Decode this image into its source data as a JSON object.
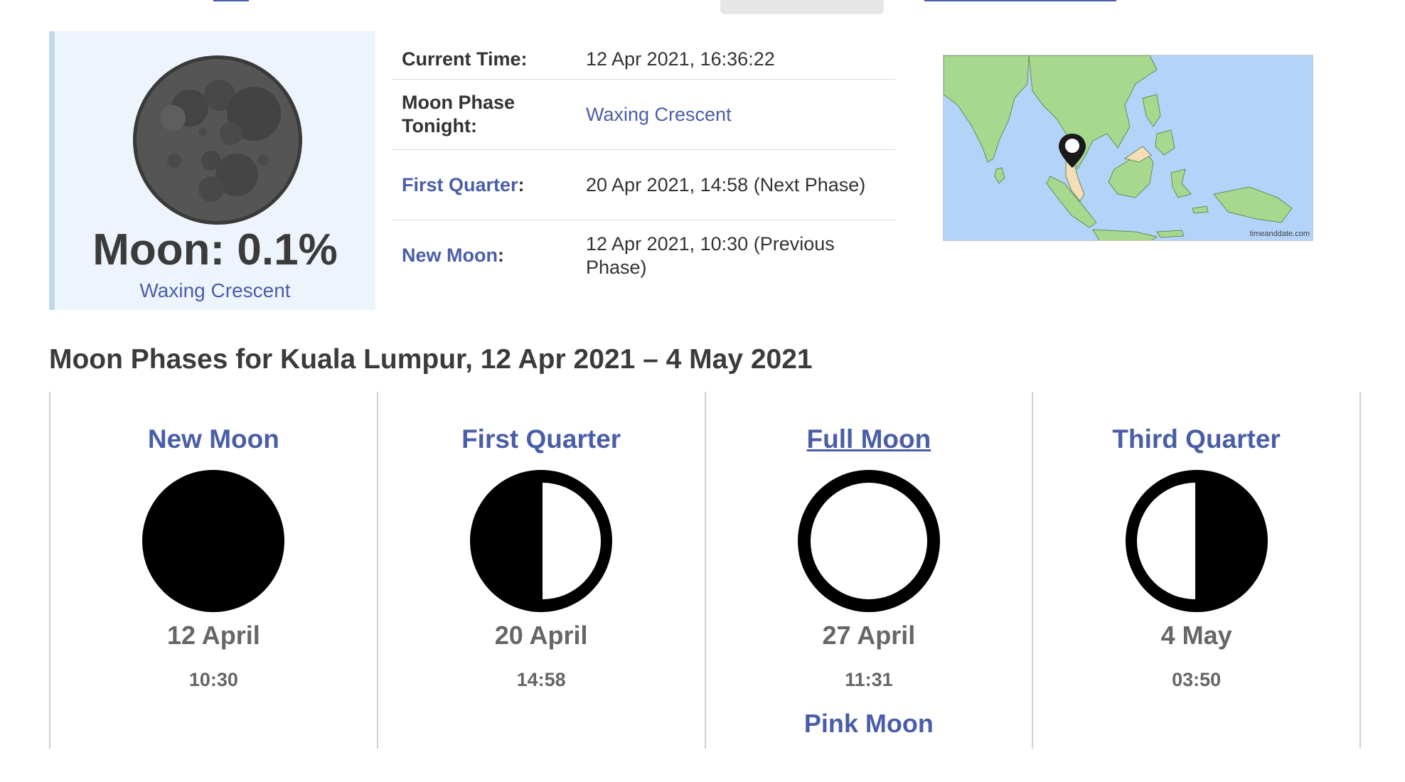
{
  "summary": {
    "percent_label": "Moon: 0.1%",
    "phase_label": "Waxing Crescent",
    "illumination_percent": 0.1
  },
  "info": {
    "current_time_label": "Current Time:",
    "current_time_value": "12 Apr 2021, 16:36:22",
    "tonight_label": "Moon Phase Tonight:",
    "tonight_value": "Waxing Crescent",
    "first_quarter_label": "First Quarter",
    "first_quarter_value": "20 Apr 2021, 14:58 (Next Phase)",
    "new_moon_label": "New Moon",
    "new_moon_value": "12 Apr 2021, 10:30 (Previous Phase)",
    "colon": ":"
  },
  "map": {
    "credit": "timeanddate.com",
    "land_color": "#a8d88e",
    "water_color": "#b3d3f8"
  },
  "section_title": "Moon Phases for Kuala Lumpur, 12 Apr 2021 – 4 May 2021",
  "phases": [
    {
      "name": "New Moon",
      "date": "12 April",
      "time": "10:30",
      "extra": ""
    },
    {
      "name": "First Quarter",
      "date": "20 April",
      "time": "14:58",
      "extra": ""
    },
    {
      "name": "Full Moon",
      "date": "27 April",
      "time": "11:31",
      "extra": "Pink Moon"
    },
    {
      "name": "Third Quarter",
      "date": "4 May",
      "time": "03:50",
      "extra": ""
    }
  ],
  "colors": {
    "link": "#4a5ea8",
    "card_bg": "#eef4fc",
    "card_accent": "#c2d6ee"
  },
  "icons": [
    "moon-photo-icon",
    "location-pin-icon",
    "new-moon-icon",
    "first-quarter-icon",
    "full-moon-icon",
    "third-quarter-icon"
  ]
}
